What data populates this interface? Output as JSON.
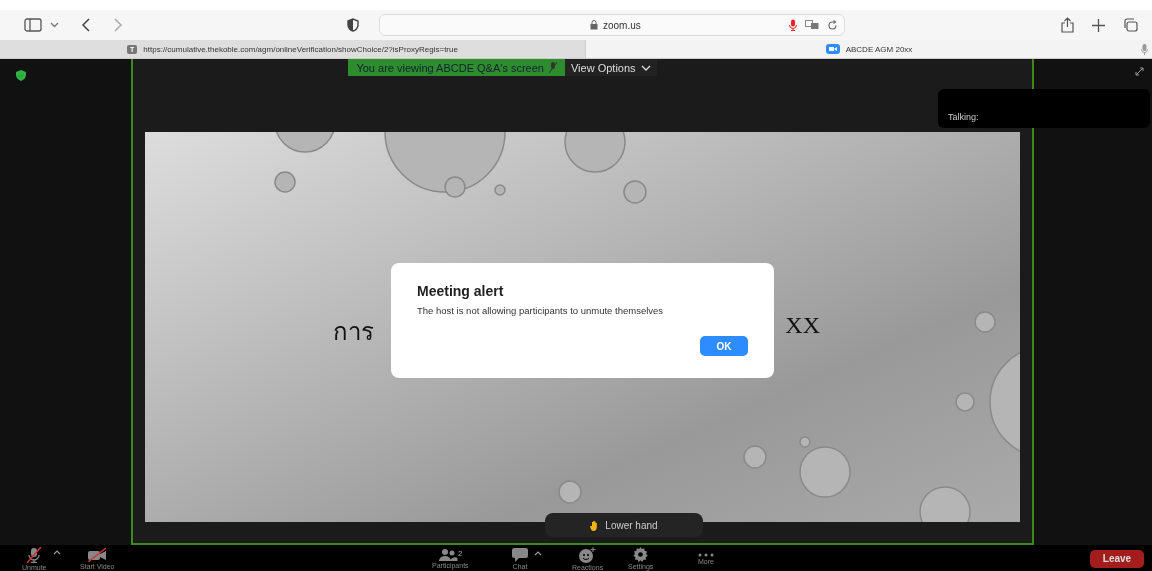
{
  "browser": {
    "address": "zoom.us",
    "tabs": [
      {
        "label": "https://cumulative.thekoble.com/agm/onlineVerification/showChoice/2?isProxyRegis=true",
        "favicon": "T",
        "selected": false
      },
      {
        "label": "ABCDE AGM 20xx",
        "selected": true
      }
    ]
  },
  "meeting": {
    "share_banner": "You are viewing ABCDE Q&A's screen",
    "view_options": "View Options",
    "talking": "Talking:",
    "slide": {
      "text_left": "การ",
      "text_right": "XX"
    },
    "lower_hand": "Lower hand",
    "toolbar": [
      {
        "kind": "mic-off",
        "label": "Unmute",
        "caret": true
      },
      {
        "kind": "video-off",
        "label": "Start Video",
        "caret": false
      },
      {
        "kind": "participants",
        "label": "Participants",
        "count": "2",
        "caret": false
      },
      {
        "kind": "chat",
        "label": "Chat",
        "caret": true
      },
      {
        "kind": "reactions",
        "label": "Reactions",
        "caret": false
      },
      {
        "kind": "settings",
        "label": "Settings",
        "caret": false
      },
      {
        "kind": "more",
        "label": "More",
        "caret": false
      }
    ],
    "leave": "Leave"
  },
  "dialog": {
    "title": "Meeting alert",
    "message": "The host is not allowing participants to unmute themselves",
    "button": "OK"
  }
}
